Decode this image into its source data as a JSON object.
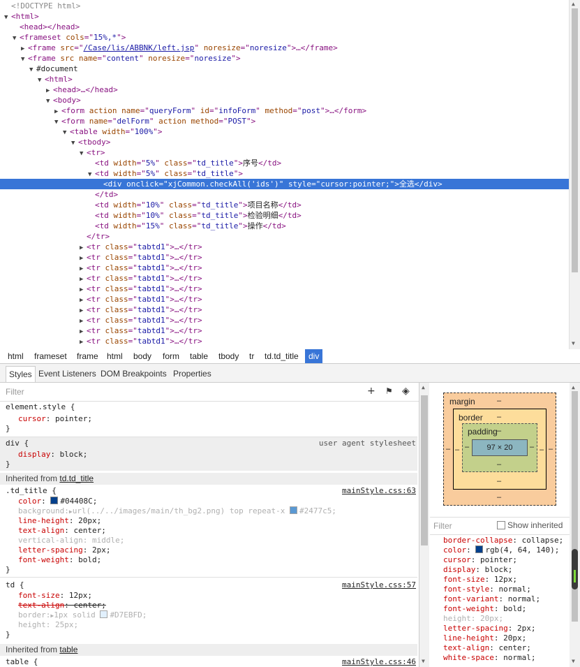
{
  "dom_tree": {
    "lines": [
      {
        "indent": 0,
        "tri": "",
        "parts": [
          [
            "comment",
            "<!DOCTYPE html>"
          ]
        ]
      },
      {
        "indent": 0,
        "tri": "▼",
        "parts": [
          [
            "tag",
            "<html>"
          ]
        ]
      },
      {
        "indent": 1,
        "tri": "",
        "parts": [
          [
            "tag",
            "<head></head>"
          ]
        ]
      },
      {
        "indent": 1,
        "tri": "▼",
        "parts": [
          [
            "tag",
            "<frameset "
          ],
          [
            "attr-name",
            "cols"
          ],
          [
            "tag",
            "=\""
          ],
          [
            "attr-val",
            "15%,*"
          ],
          [
            "tag",
            "\">"
          ]
        ]
      },
      {
        "indent": 2,
        "tri": "▶",
        "parts": [
          [
            "tag",
            "<frame "
          ],
          [
            "attr-name",
            "src"
          ],
          [
            "tag",
            "=\""
          ],
          [
            "link-val",
            "/Case/lis/ABBNK/left.jsp"
          ],
          [
            "tag",
            "\" "
          ],
          [
            "attr-name",
            "noresize"
          ],
          [
            "tag",
            "=\""
          ],
          [
            "attr-val",
            "noresize"
          ],
          [
            "tag",
            "\">…</frame>"
          ]
        ]
      },
      {
        "indent": 2,
        "tri": "▼",
        "parts": [
          [
            "tag",
            "<frame "
          ],
          [
            "attr-name",
            "src name"
          ],
          [
            "tag",
            "=\""
          ],
          [
            "attr-val",
            "content"
          ],
          [
            "tag",
            "\" "
          ],
          [
            "attr-name",
            "noresize"
          ],
          [
            "tag",
            "=\""
          ],
          [
            "attr-val",
            "noresize"
          ],
          [
            "tag",
            "\">"
          ]
        ]
      },
      {
        "indent": 3,
        "tri": "▼",
        "parts": [
          [
            "text",
            "#document"
          ]
        ]
      },
      {
        "indent": 4,
        "tri": "▼",
        "parts": [
          [
            "tag",
            "<html>"
          ]
        ]
      },
      {
        "indent": 5,
        "tri": "▶",
        "parts": [
          [
            "tag",
            "<head>…</head>"
          ]
        ]
      },
      {
        "indent": 5,
        "tri": "▼",
        "parts": [
          [
            "tag",
            "<body>"
          ]
        ]
      },
      {
        "indent": 6,
        "tri": "▶",
        "parts": [
          [
            "tag",
            "<form "
          ],
          [
            "attr-name",
            "action name"
          ],
          [
            "tag",
            "=\""
          ],
          [
            "attr-val",
            "queryForm"
          ],
          [
            "tag",
            "\" "
          ],
          [
            "attr-name",
            "id"
          ],
          [
            "tag",
            "=\""
          ],
          [
            "attr-val",
            "infoForm"
          ],
          [
            "tag",
            "\" "
          ],
          [
            "attr-name",
            "method"
          ],
          [
            "tag",
            "=\""
          ],
          [
            "attr-val",
            "post"
          ],
          [
            "tag",
            "\">…</form>"
          ]
        ]
      },
      {
        "indent": 6,
        "tri": "▼",
        "parts": [
          [
            "tag",
            "<form "
          ],
          [
            "attr-name",
            "name"
          ],
          [
            "tag",
            "=\""
          ],
          [
            "attr-val",
            "delForm"
          ],
          [
            "tag",
            "\" "
          ],
          [
            "attr-name",
            "action method"
          ],
          [
            "tag",
            "=\""
          ],
          [
            "attr-val",
            "POST"
          ],
          [
            "tag",
            "\">"
          ]
        ]
      },
      {
        "indent": 7,
        "tri": "▼",
        "parts": [
          [
            "tag",
            "<table "
          ],
          [
            "attr-name",
            "width"
          ],
          [
            "tag",
            "=\""
          ],
          [
            "attr-val",
            "100%"
          ],
          [
            "tag",
            "\">"
          ]
        ]
      },
      {
        "indent": 8,
        "tri": "▼",
        "parts": [
          [
            "tag",
            "<tbody>"
          ]
        ]
      },
      {
        "indent": 9,
        "tri": "▼",
        "parts": [
          [
            "tag",
            "<tr>"
          ]
        ]
      },
      {
        "indent": 10,
        "tri": "",
        "parts": [
          [
            "tag",
            "<td "
          ],
          [
            "attr-name",
            "width"
          ],
          [
            "tag",
            "=\""
          ],
          [
            "attr-val",
            "5%"
          ],
          [
            "tag",
            "\" "
          ],
          [
            "attr-name",
            "class"
          ],
          [
            "tag",
            "=\""
          ],
          [
            "attr-val",
            "td_title"
          ],
          [
            "tag",
            "\">"
          ],
          [
            "text",
            "序号"
          ],
          [
            "tag",
            "</td>"
          ]
        ]
      },
      {
        "indent": 10,
        "tri": "▼",
        "parts": [
          [
            "tag",
            "<td "
          ],
          [
            "attr-name",
            "width"
          ],
          [
            "tag",
            "=\""
          ],
          [
            "attr-val",
            "5%"
          ],
          [
            "tag",
            "\" "
          ],
          [
            "attr-name",
            "class"
          ],
          [
            "tag",
            "=\""
          ],
          [
            "attr-val",
            "td_title"
          ],
          [
            "tag",
            "\">"
          ]
        ]
      },
      {
        "indent": 11,
        "tri": "",
        "selected": true,
        "parts": [
          [
            "tag",
            "<div "
          ],
          [
            "attr-name",
            "onclick"
          ],
          [
            "tag",
            "=\""
          ],
          [
            "attr-val",
            "xjCommon.checkAll('ids')"
          ],
          [
            "tag",
            "\" "
          ],
          [
            "attr-name",
            "style"
          ],
          [
            "tag",
            "=\""
          ],
          [
            "attr-val",
            "cursor:pointer;"
          ],
          [
            "tag",
            "\">"
          ],
          [
            "text",
            "全选"
          ],
          [
            "tag",
            "</div>"
          ]
        ]
      },
      {
        "indent": 10,
        "tri": "",
        "parts": [
          [
            "tag",
            "</td>"
          ]
        ]
      },
      {
        "indent": 10,
        "tri": "",
        "parts": [
          [
            "tag",
            "<td "
          ],
          [
            "attr-name",
            "width"
          ],
          [
            "tag",
            "=\""
          ],
          [
            "attr-val",
            "10%"
          ],
          [
            "tag",
            "\" "
          ],
          [
            "attr-name",
            "class"
          ],
          [
            "tag",
            "=\""
          ],
          [
            "attr-val",
            "td_title"
          ],
          [
            "tag",
            "\">"
          ],
          [
            "text",
            "项目名称"
          ],
          [
            "tag",
            "</td>"
          ]
        ]
      },
      {
        "indent": 10,
        "tri": "",
        "parts": [
          [
            "tag",
            "<td "
          ],
          [
            "attr-name",
            "width"
          ],
          [
            "tag",
            "=\""
          ],
          [
            "attr-val",
            "10%"
          ],
          [
            "tag",
            "\" "
          ],
          [
            "attr-name",
            "class"
          ],
          [
            "tag",
            "=\""
          ],
          [
            "attr-val",
            "td_title"
          ],
          [
            "tag",
            "\">"
          ],
          [
            "text",
            "检验明细"
          ],
          [
            "tag",
            "</td>"
          ]
        ]
      },
      {
        "indent": 10,
        "tri": "",
        "parts": [
          [
            "tag",
            "<td "
          ],
          [
            "attr-name",
            "width"
          ],
          [
            "tag",
            "=\""
          ],
          [
            "attr-val",
            "15%"
          ],
          [
            "tag",
            "\" "
          ],
          [
            "attr-name",
            "class"
          ],
          [
            "tag",
            "=\""
          ],
          [
            "attr-val",
            "td_title"
          ],
          [
            "tag",
            "\">"
          ],
          [
            "text",
            "操作"
          ],
          [
            "tag",
            "</td>"
          ]
        ]
      },
      {
        "indent": 9,
        "tri": "",
        "parts": [
          [
            "tag",
            "</tr>"
          ]
        ]
      },
      {
        "indent": 9,
        "tri": "▶",
        "parts": [
          [
            "tag",
            "<tr "
          ],
          [
            "attr-name",
            "class"
          ],
          [
            "tag",
            "=\""
          ],
          [
            "attr-val",
            "tabtd1"
          ],
          [
            "tag",
            "\">…</tr>"
          ]
        ]
      },
      {
        "indent": 9,
        "tri": "▶",
        "parts": [
          [
            "tag",
            "<tr "
          ],
          [
            "attr-name",
            "class"
          ],
          [
            "tag",
            "=\""
          ],
          [
            "attr-val",
            "tabtd1"
          ],
          [
            "tag",
            "\">…</tr>"
          ]
        ]
      },
      {
        "indent": 9,
        "tri": "▶",
        "parts": [
          [
            "tag",
            "<tr "
          ],
          [
            "attr-name",
            "class"
          ],
          [
            "tag",
            "=\""
          ],
          [
            "attr-val",
            "tabtd1"
          ],
          [
            "tag",
            "\">…</tr>"
          ]
        ]
      },
      {
        "indent": 9,
        "tri": "▶",
        "parts": [
          [
            "tag",
            "<tr "
          ],
          [
            "attr-name",
            "class"
          ],
          [
            "tag",
            "=\""
          ],
          [
            "attr-val",
            "tabtd1"
          ],
          [
            "tag",
            "\">…</tr>"
          ]
        ]
      },
      {
        "indent": 9,
        "tri": "▶",
        "parts": [
          [
            "tag",
            "<tr "
          ],
          [
            "attr-name",
            "class"
          ],
          [
            "tag",
            "=\""
          ],
          [
            "attr-val",
            "tabtd1"
          ],
          [
            "tag",
            "\">…</tr>"
          ]
        ]
      },
      {
        "indent": 9,
        "tri": "▶",
        "parts": [
          [
            "tag",
            "<tr "
          ],
          [
            "attr-name",
            "class"
          ],
          [
            "tag",
            "=\""
          ],
          [
            "attr-val",
            "tabtd1"
          ],
          [
            "tag",
            "\">…</tr>"
          ]
        ]
      },
      {
        "indent": 9,
        "tri": "▶",
        "parts": [
          [
            "tag",
            "<tr "
          ],
          [
            "attr-name",
            "class"
          ],
          [
            "tag",
            "=\""
          ],
          [
            "attr-val",
            "tabtd1"
          ],
          [
            "tag",
            "\">…</tr>"
          ]
        ]
      },
      {
        "indent": 9,
        "tri": "▶",
        "parts": [
          [
            "tag",
            "<tr "
          ],
          [
            "attr-name",
            "class"
          ],
          [
            "tag",
            "=\""
          ],
          [
            "attr-val",
            "tabtd1"
          ],
          [
            "tag",
            "\">…</tr>"
          ]
        ]
      },
      {
        "indent": 9,
        "tri": "▶",
        "parts": [
          [
            "tag",
            "<tr "
          ],
          [
            "attr-name",
            "class"
          ],
          [
            "tag",
            "=\""
          ],
          [
            "attr-val",
            "tabtd1"
          ],
          [
            "tag",
            "\">…</tr>"
          ]
        ]
      },
      {
        "indent": 9,
        "tri": "▶",
        "parts": [
          [
            "tag",
            "<tr "
          ],
          [
            "attr-name",
            "class"
          ],
          [
            "tag",
            "=\""
          ],
          [
            "attr-val",
            "tabtd1"
          ],
          [
            "tag",
            "\">…</tr>"
          ]
        ]
      }
    ]
  },
  "breadcrumbs": [
    "html",
    "frameset",
    "frame",
    "html",
    "body",
    "form",
    "table",
    "tbody",
    "tr",
    "td.td_title",
    "div"
  ],
  "tabs": [
    "Styles",
    "Event Listeners",
    "DOM Breakpoints",
    "Properties"
  ],
  "styles": {
    "filter_placeholder": "Filter",
    "tools": {
      "new_rule": "+",
      "pin": "📌",
      "toggle": "◈"
    },
    "element_style": {
      "selector": "element.style {",
      "prop": "cursor",
      "value": "pointer;",
      "close": "}"
    },
    "div_rule": {
      "selector": "div {",
      "source": "user agent stylesheet",
      "prop": "display",
      "value": "block;",
      "close": "}"
    },
    "inherited1": {
      "label": "Inherited from ",
      "link": "td.td_title"
    },
    "td_title_rule": {
      "selector": ".td_title {",
      "source": "mainStyle.css:63",
      "props": [
        {
          "name": "color",
          "value": "#04408C;",
          "swatch": "#04408C",
          "dim": false
        },
        {
          "name": "background",
          "value": "url(../../images/main/th_bg2.png) top repeat-x ",
          "tail": "#2477c5;",
          "swatch2": "#2477c5",
          "dim": true,
          "arrow": true
        },
        {
          "name": "line-height",
          "value": "20px;",
          "dim": false
        },
        {
          "name": "text-align",
          "value": "center;",
          "dim": false
        },
        {
          "name": "vertical-align",
          "value": "middle;",
          "dim": true
        },
        {
          "name": "letter-spacing",
          "value": "2px;",
          "dim": false
        },
        {
          "name": "font-weight",
          "value": "bold;",
          "dim": false
        }
      ],
      "close": "}"
    },
    "td_rule": {
      "selector": "td {",
      "source": "mainStyle.css:57",
      "props": [
        {
          "name": "font-size",
          "value": "12px;",
          "dim": false
        },
        {
          "name": "text-align",
          "value": "center;",
          "dim": false,
          "strike": true
        },
        {
          "name": "border",
          "value": "1px solid ",
          "tail": "#D7EBFD;",
          "swatch2": "#D7EBFD",
          "dim": true,
          "arrow": true
        },
        {
          "name": "height",
          "value": "25px;",
          "dim": true
        }
      ],
      "close": "}"
    },
    "inherited2": {
      "label": "Inherited from ",
      "link": "table"
    },
    "table_rule": {
      "selector": "table {",
      "source": "mainStyle.css:46"
    }
  },
  "box_model": {
    "margin_label": "margin",
    "border_label": "border",
    "padding_label": "padding",
    "content_size": "97 × 20",
    "dash": "–"
  },
  "computed": {
    "filter_placeholder": "Filter",
    "show_inherited_label": "Show inherited",
    "props": [
      {
        "name": "border-collapse",
        "value": "collapse;",
        "dim": false
      },
      {
        "name": "color",
        "value": "rgb(4, 64, 140);",
        "swatch": "#04408C",
        "dim": false
      },
      {
        "name": "cursor",
        "value": "pointer;",
        "dim": false
      },
      {
        "name": "display",
        "value": "block;",
        "dim": false
      },
      {
        "name": "font-size",
        "value": "12px;",
        "dim": false
      },
      {
        "name": "font-style",
        "value": "normal;",
        "dim": false
      },
      {
        "name": "font-variant",
        "value": "normal;",
        "dim": false
      },
      {
        "name": "font-weight",
        "value": "bold;",
        "dim": false
      },
      {
        "name": "height",
        "value": "20px;",
        "dim": true
      },
      {
        "name": "letter-spacing",
        "value": "2px;",
        "dim": false
      },
      {
        "name": "line-height",
        "value": "20px;",
        "dim": false
      },
      {
        "name": "text-align",
        "value": "center;",
        "dim": false
      },
      {
        "name": "white-space",
        "value": "normal;",
        "dim": false
      }
    ]
  }
}
